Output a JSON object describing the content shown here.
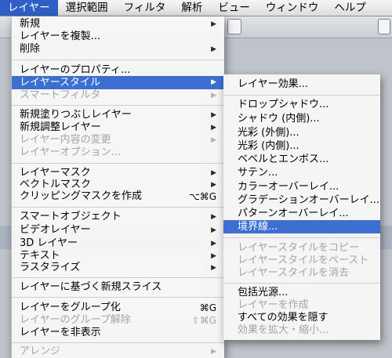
{
  "menubar": {
    "items": [
      {
        "label": "レイヤー",
        "active": true
      },
      {
        "label": "選択範囲"
      },
      {
        "label": "フィルタ"
      },
      {
        "label": "解析"
      },
      {
        "label": "ビュー"
      },
      {
        "label": "ウィンドウ"
      },
      {
        "label": "ヘルプ"
      }
    ]
  },
  "layer_menu": {
    "new": "新規",
    "duplicate": "レイヤーを複製...",
    "delete": "削除",
    "properties": "レイヤーのプロパティ...",
    "style": "レイヤースタイル",
    "smart_filter": "スマートフィルタ",
    "new_fill": "新規塗りつぶしレイヤー",
    "new_adjust": "新規調整レイヤー",
    "content_change": "レイヤー内容の変更",
    "content_options": "レイヤーオプション...",
    "layer_mask": "レイヤーマスク",
    "vector_mask": "ベクトルマスク",
    "clipping_mask": "クリッピングマスクを作成",
    "clipping_mask_shortcut": "⌥⌘G",
    "smart_object": "スマートオブジェクト",
    "video_layer": "ビデオレイヤー",
    "layer_3d": "3D レイヤー",
    "text": "テキスト",
    "rasterize": "ラスタライズ",
    "new_slice": "レイヤーに基づく新規スライス",
    "group": "レイヤーをグループ化",
    "group_shortcut": "⌘G",
    "ungroup": "レイヤーのグループ解除",
    "ungroup_shortcut": "⇧⌘G",
    "hide": "レイヤーを非表示",
    "arrange": "アレンジ"
  },
  "style_submenu": {
    "blending": "レイヤー効果...",
    "drop_shadow": "ドロップシャドウ...",
    "inner_shadow": "シャドウ (内側)...",
    "outer_glow": "光彩 (外側)...",
    "inner_glow": "光彩 (内側)...",
    "bevel": "ベベルとエンボス...",
    "satin": "サテン...",
    "color_overlay": "カラーオーバーレイ...",
    "gradient_overlay": "グラデーションオーバーレイ...",
    "pattern_overlay": "パターンオーバーレイ...",
    "stroke": "境界線...",
    "copy_style": "レイヤースタイルをコピー",
    "paste_style": "レイヤースタイルをペースト",
    "clear_style": "レイヤースタイルを消去",
    "global_light": "包括光源...",
    "create_layer": "レイヤーを作成",
    "hide_effects": "すべての効果を隠す",
    "scale_effects": "効果を拡大・縮小..."
  },
  "colors": {
    "highlight": "#3d6fd0",
    "menubar_active": "#2f5fc6",
    "disabled_text": "#a4a4a4"
  }
}
